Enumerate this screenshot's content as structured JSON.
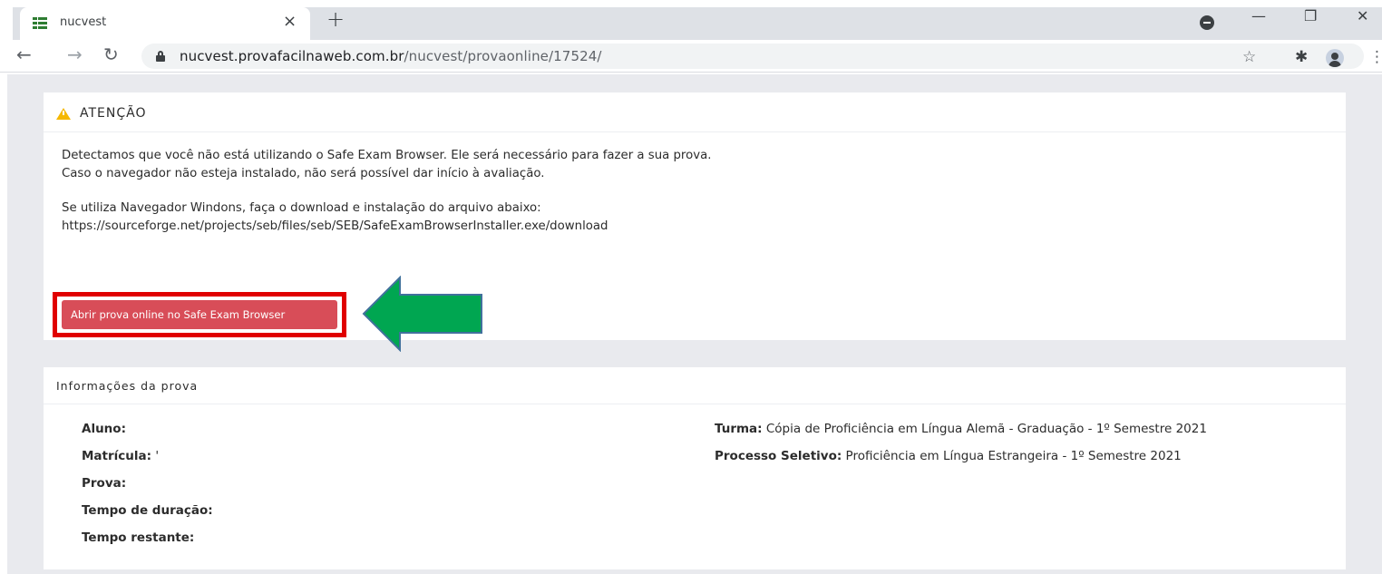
{
  "browser": {
    "tab_title": "nucvest",
    "tab_close": "×",
    "new_tab": "+",
    "url_domain": "nucvest.provafacilnaweb.com.br",
    "url_path": "/nucvest/provaonline/17524/",
    "window_controls": {
      "minimize": "—",
      "restore": "❐",
      "close": "✕"
    },
    "icons": [
      "tab-favicon-icon",
      "back-icon",
      "forward-icon",
      "reload-icon",
      "lock-icon",
      "star-icon",
      "extensions-icon",
      "profile-icon",
      "menu-icon"
    ]
  },
  "alert": {
    "title": "ATENÇÃO",
    "line1": "Detectamos que você não está utilizando o Safe Exam Browser. Ele será necessário para fazer a sua prova.",
    "line2": " Caso o navegador não esteja instalado, não será possível dar início à avaliação.",
    "line3": "Se utiliza Navegador Windons, faça o download e instalação do arquivo abaixo:",
    "line4": "https://sourceforge.net/projects/seb/files/seb/SEB/SafeExamBrowserInstaller.exe/download",
    "button_label": "Abrir prova online no Safe Exam Browser"
  },
  "info": {
    "title": "Informações da prova",
    "aluno_label": "Aluno:",
    "matricula_label": "Matrícula:",
    "matricula_value": " '",
    "prova_label": "Prova:",
    "duracao_label": "Tempo de duração:",
    "restante_label": "Tempo restante:",
    "turma_label": "Turma:",
    "turma_value": " Cópia de Proficiência em Língua Alemã - Graduação - 1º Semestre 2021",
    "processo_label": "Processo Seletivo:",
    "processo_value": " Proficiência em Língua Estrangeira - 1º Semestre 2021"
  },
  "colors": {
    "button": "#d84d58",
    "highlight_border": "#e00000",
    "arrow_fill": "#00a651",
    "arrow_stroke": "#41719c",
    "warning": "#f5b800"
  }
}
